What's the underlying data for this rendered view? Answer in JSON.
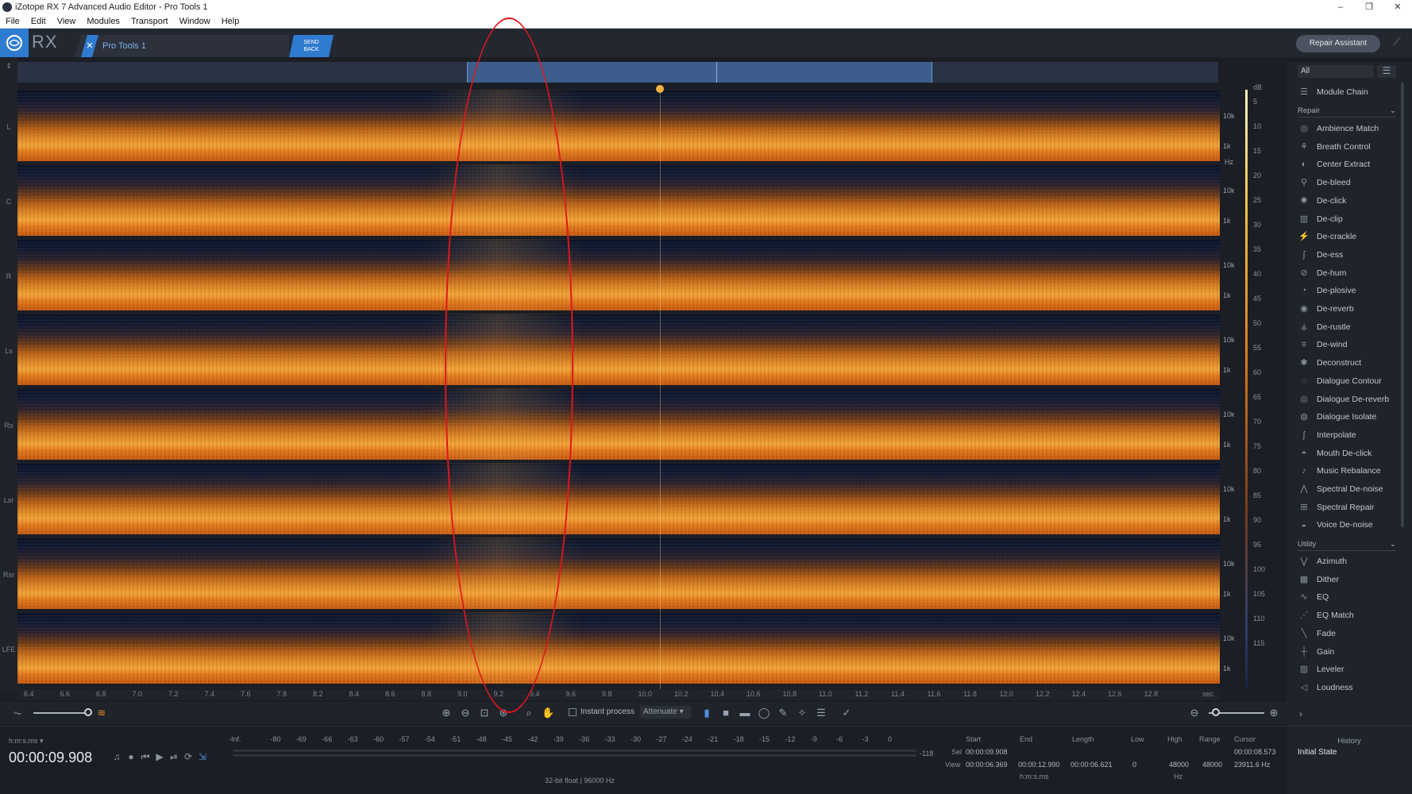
{
  "window": {
    "title": "iZotope RX 7 Advanced Audio Editor - Pro Tools 1",
    "controls": [
      "–",
      "❐",
      "✕"
    ]
  },
  "menu": [
    "File",
    "Edit",
    "View",
    "Modules",
    "Transport",
    "Window",
    "Help"
  ],
  "header": {
    "logo_text": "RX",
    "doc_tab": "Pro Tools 1",
    "send_back": [
      "SEND",
      "BACK"
    ],
    "repair_assistant": "Repair Assistant"
  },
  "channels": [
    "L",
    "C",
    "R",
    "Ls",
    "Rs",
    "Lsr",
    "Rsr",
    "LFE"
  ],
  "freq_labels": [
    "10k",
    "1k"
  ],
  "freq_unit": "Hz",
  "db_scale": {
    "unit": "dB",
    "values": [
      "5",
      "10",
      "15",
      "20",
      "25",
      "30",
      "35",
      "40",
      "45",
      "50",
      "55",
      "60",
      "65",
      "70",
      "75",
      "80",
      "85",
      "90",
      "95",
      "100",
      "105",
      "110",
      "115"
    ]
  },
  "time_ticks": [
    "6.4",
    "6.6",
    "6.8",
    "7.0",
    "7.2",
    "7.4",
    "7.6",
    "7.8",
    "8.2",
    "8.4",
    "8.6",
    "8.8",
    "9.0",
    "9.2",
    "9.4",
    "9.6",
    "9.8",
    "10.0",
    "10.2",
    "10.4",
    "10.6",
    "10.8",
    "11.0",
    "11.2",
    "11.4",
    "11.6",
    "11.8",
    "12.0",
    "12.2",
    "12.4",
    "12.6",
    "12.8"
  ],
  "time_unit": "sec",
  "toolbar": {
    "instant_process": "Instant process",
    "attenuate": "Attenuate"
  },
  "transport": {
    "time_format": "h:m:s.ms",
    "current_time": "00:00:09.908"
  },
  "meter": {
    "labels": [
      "-Inf.",
      "-80",
      "-69",
      "-66",
      "-63",
      "-60",
      "-57",
      "-54",
      "-51",
      "-48",
      "-45",
      "-42",
      "-39",
      "-36",
      "-33",
      "-30",
      "-27",
      "-24",
      "-21",
      "-18",
      "-15",
      "-12",
      "-9",
      "-6",
      "-3",
      "0"
    ],
    "peak": "-118",
    "format": "32-bit float | 96000 Hz"
  },
  "selection": {
    "headers": {
      "start": "Start",
      "end": "End",
      "length": "Length",
      "low": "Low",
      "high": "High",
      "range": "Range",
      "cursor": "Cursor"
    },
    "sel_label": "Sel",
    "view_label": "View",
    "sel": {
      "start": "00:00:09.908"
    },
    "view": {
      "start": "00:00:06.369",
      "end": "00:00:12.990",
      "length": "00:00:06.621",
      "low": "0",
      "high": "48000",
      "range": "48000"
    },
    "cursor_time": "00:00:08.573",
    "cursor_freq": "23911.6 Hz",
    "time_unit": "h:m:s.ms",
    "freq_unit": "Hz"
  },
  "modules": {
    "filter": "All",
    "chain": "Module Chain",
    "repair_title": "Repair",
    "repair": [
      "Ambience Match",
      "Breath Control",
      "Center Extract",
      "De-bleed",
      "De-click",
      "De-clip",
      "De-crackle",
      "De-ess",
      "De-hum",
      "De-plosive",
      "De-reverb",
      "De-rustle",
      "De-wind",
      "Deconstruct",
      "Dialogue Contour",
      "Dialogue De-reverb",
      "Dialogue Isolate",
      "Interpolate",
      "Mouth De-click",
      "Music Rebalance",
      "Spectral De-noise",
      "Spectral Repair",
      "Voice De-noise"
    ],
    "utility_title": "Utility",
    "utility": [
      "Azimuth",
      "Dither",
      "EQ",
      "EQ Match",
      "Fade",
      "Gain",
      "Leveler",
      "Loudness"
    ]
  },
  "history": {
    "title": "History",
    "items": [
      "Initial State"
    ]
  }
}
